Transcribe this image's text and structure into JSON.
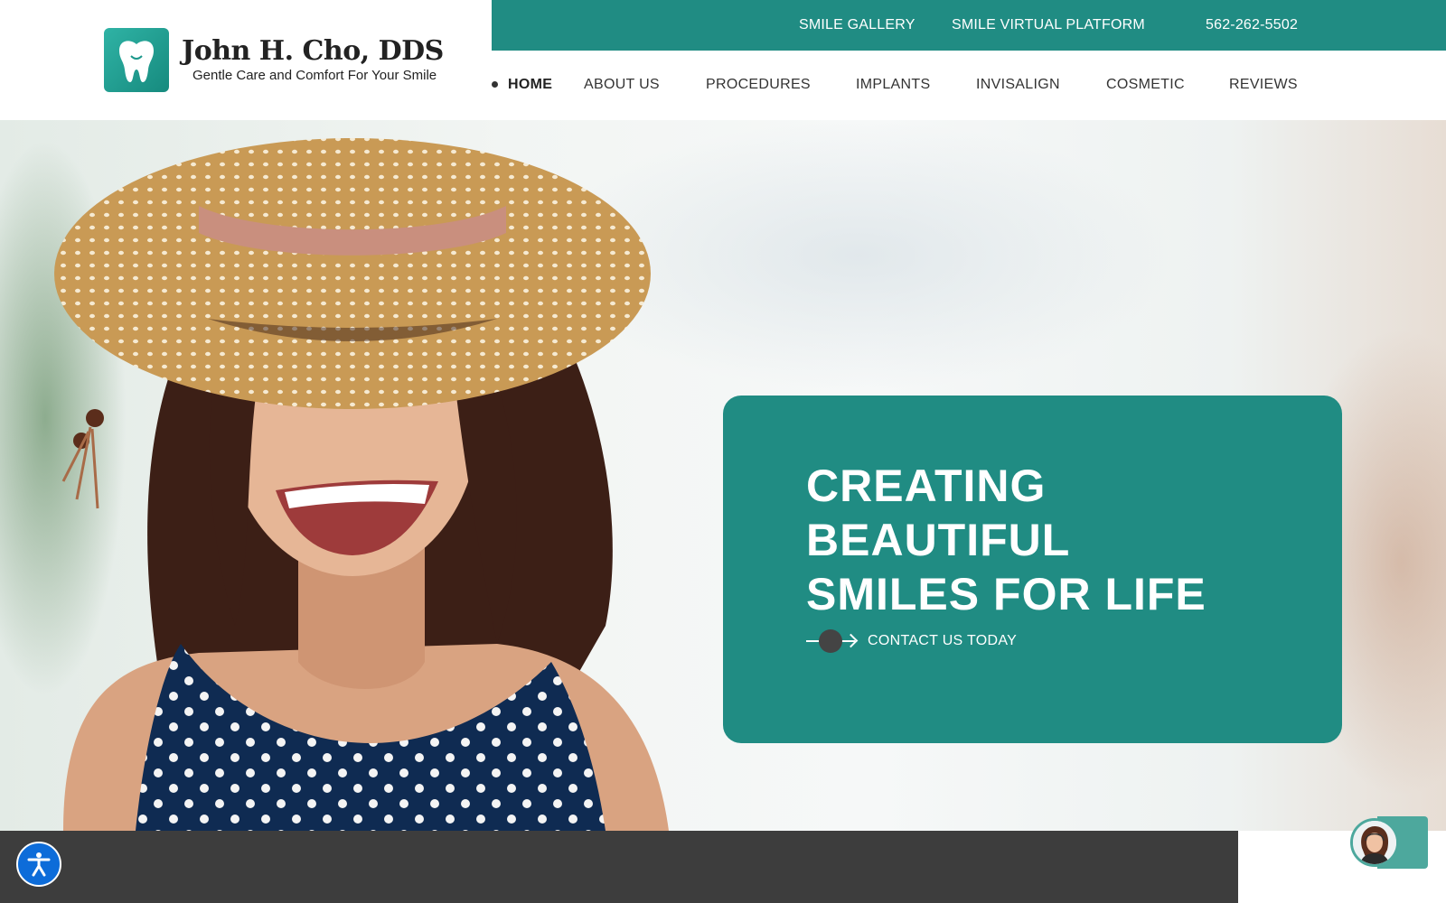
{
  "brand": {
    "name": "John H. Cho, DDS",
    "tagline": "Gentle Care and Comfort For Your Smile",
    "color_teal": "#208c83",
    "color_dark": "#3d3d3d"
  },
  "topbar": {
    "links": [
      "SMILE GALLERY",
      "SMILE VIRTUAL PLATFORM"
    ],
    "phone": "562-262-5502"
  },
  "nav": {
    "items": [
      "HOME",
      "ABOUT US",
      "PROCEDURES",
      "IMPLANTS",
      "INVISALIGN",
      "COSMETIC",
      "REVIEWS"
    ],
    "active": "HOME"
  },
  "hero": {
    "headline": [
      "CREATING",
      "BEAUTIFUL",
      "SMILES FOR LIFE"
    ],
    "cta": "CONTACT US TODAY"
  },
  "icons": {
    "logo": "tooth-icon",
    "cta": "arrow-right-icon",
    "accessibility": "accessibility-icon",
    "chat": "chat-agent-avatar-icon"
  }
}
